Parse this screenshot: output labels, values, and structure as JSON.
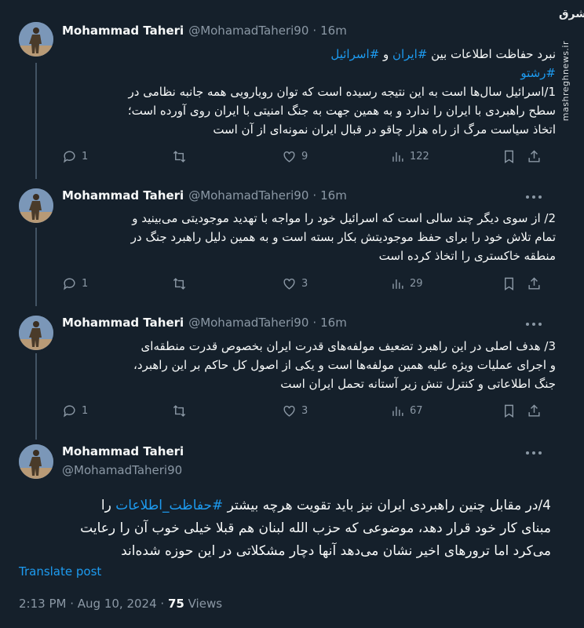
{
  "watermark": {
    "logo": "مشرق",
    "site": "mashreghnews.ir"
  },
  "author": {
    "name": "Mohammad Taheri",
    "handle": "@MohamadTaheri90"
  },
  "tweets": [
    {
      "time": "16m",
      "lines": [
        "نبرد حفاظت اطلاعات بین #ایران و #اسرائیل",
        "#رشتو",
        "1/اسرائیل سال‌ها است به این نتیجه رسیده است که توان رویارویی همه جانبه نظامی در",
        "سطح راهبردی با ایران را ندارد و به همین جهت به جنگ امنیتی با ایران روی آورده است؛",
        "اتخاذ سیاست مرگ از راه هزار چاقو در قبال ایران نمونه‌ای از آن است"
      ],
      "replies": "1",
      "retweets": "",
      "likes": "9",
      "views": "122"
    },
    {
      "time": "16m",
      "lines": [
        "2/ از سوی دیگر چند سالی است که اسرائیل خود را مواجه با تهدید موجودیتی می‌بینید و",
        "تمام تلاش خود را برای حفظ موجودیتش بکار بسته است و به همین دلیل راهبرد جنگ در",
        "منطقه خاکستری را اتخاذ کرده است"
      ],
      "replies": "1",
      "retweets": "",
      "likes": "3",
      "views": "29"
    },
    {
      "time": "16m",
      "lines": [
        "3/ هدف اصلی در این راهبرد تضعیف مولفه‌های قدرت ایران بخصوص قدرت منطقه‌ای",
        "و اجرای عملیات ویژه علیه همین مولفه‌ها است و یکی از اصول کل حاکم بر این راهبرد،",
        "جنگ اطلاعاتی و کنترل تنش زیر آستانه تحمل ایران است"
      ],
      "replies": "1",
      "retweets": "",
      "likes": "3",
      "views": "67"
    }
  ],
  "main_tweet": {
    "lines": [
      "4/در مقابل چنین راهبردی ایران نیز باید تقویت هرچه بیشتر #حفاظت_اطلاعات را",
      "مبنای کار خود قرار دهد، موضوعی که حزب الله لبنان هم قبلا خیلی خوب آن را رعایت",
      "می‌کرد اما ترورهای اخیر نشان می‌دهد آنها دچار مشکلاتی در این حوزه شده‌اند"
    ],
    "translate": "Translate post",
    "time": "2:13 PM",
    "date": "Aug 10, 2024",
    "views_count": "75",
    "views_label": "Views"
  }
}
